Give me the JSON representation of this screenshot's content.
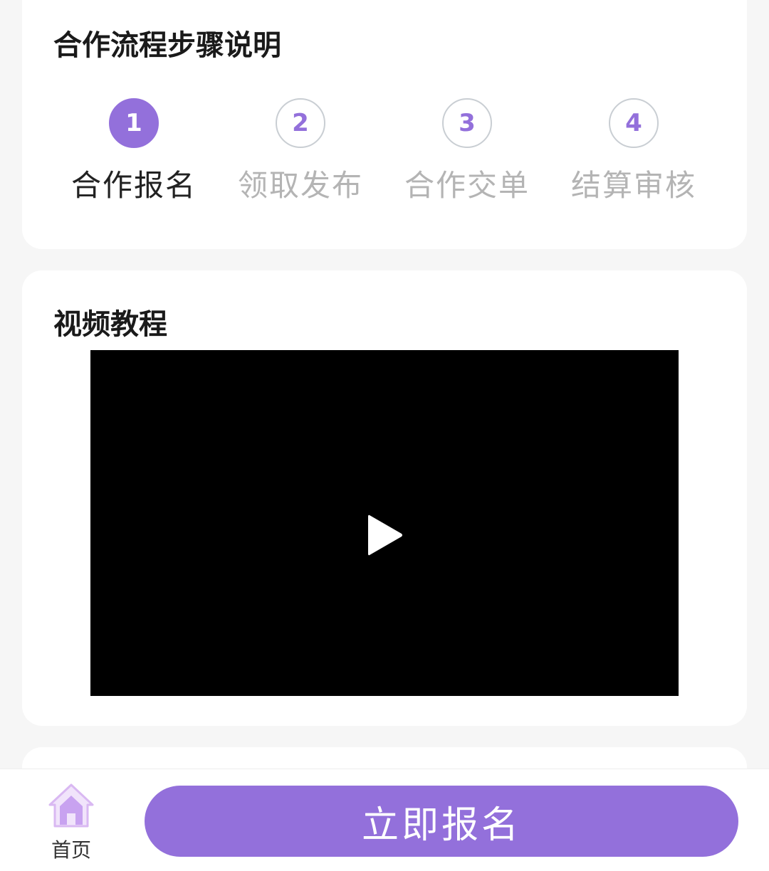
{
  "process": {
    "title": "合作流程步骤说明",
    "steps": [
      {
        "number": "1",
        "label": "合作报名",
        "active": true
      },
      {
        "number": "2",
        "label": "领取发布",
        "active": false
      },
      {
        "number": "3",
        "label": "合作交单",
        "active": false
      },
      {
        "number": "4",
        "label": "结算审核",
        "active": false
      }
    ]
  },
  "video_section": {
    "title": "视频教程",
    "player_icon": "play-icon"
  },
  "bottom_bar": {
    "home_label": "首页",
    "home_icon": "home-icon",
    "signup_label": "立即报名"
  },
  "colors": {
    "accent": "#9370db",
    "inactive_text": "#b4b4b4",
    "page_background": "#f6f6f6"
  }
}
